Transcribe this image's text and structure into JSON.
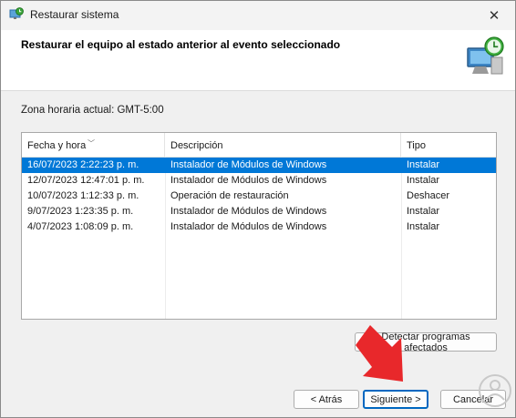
{
  "window": {
    "title": "Restaurar sistema",
    "close_glyph": "✕"
  },
  "header": {
    "title": "Restaurar el equipo al estado anterior al evento seleccionado"
  },
  "timezone": {
    "label": "Zona horaria actual: GMT-5:00"
  },
  "table": {
    "columns": [
      "Fecha y hora",
      "Descripción",
      "Tipo"
    ],
    "rows": [
      [
        "16/07/2023 2:22:23 p. m.",
        "Instalador de Módulos de Windows",
        "Instalar"
      ],
      [
        "12/07/2023 12:47:01 p. m.",
        "Instalador de Módulos de Windows",
        "Instalar"
      ],
      [
        "10/07/2023 1:12:33 p. m.",
        "Operación de restauración",
        "Deshacer"
      ],
      [
        "9/07/2023 1:23:35 p. m.",
        "Instalador de Módulos de Windows",
        "Instalar"
      ],
      [
        "4/07/2023 1:08:09 p. m.",
        "Instalador de Módulos de Windows",
        "Instalar"
      ]
    ],
    "selected_row": 0
  },
  "buttons": {
    "detect": "Detectar programas afectados",
    "back": "< Atrás",
    "next": "Siguiente >",
    "cancel": "Cancelar"
  },
  "colors": {
    "selection": "#0078d7",
    "arrow": "#e8282b",
    "accent": "#0067c0"
  }
}
